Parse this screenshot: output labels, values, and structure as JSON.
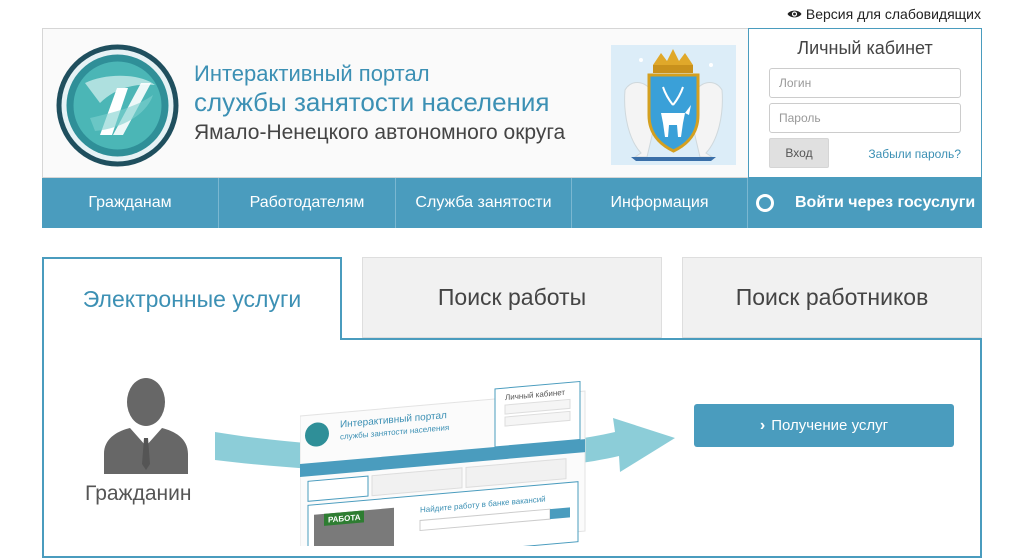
{
  "top": {
    "low_vision_label": "Версия для слабовидящих"
  },
  "header": {
    "title_line1": "Интерактивный портал",
    "title_line2": "службы занятости населения",
    "title_line3": "Ямало-Ненецкого автономного округа"
  },
  "login": {
    "title": "Личный кабинет",
    "login_placeholder": "Логин",
    "password_placeholder": "Пароль",
    "submit_label": "Вход",
    "forgot_label": "Забыли пароль?"
  },
  "nav": {
    "items": [
      "Гражданам",
      "Работодателям",
      "Служба занятости",
      "Информация"
    ],
    "gosuslugi_label": "Войти через госуслуги"
  },
  "tabs": [
    "Электронные услуги",
    "Поиск работы",
    "Поиск работников"
  ],
  "panel": {
    "citizen_label": "Гражданин",
    "service_button_label": "Получение услуг",
    "preview": {
      "portal_title_1": "Интерактивный портал",
      "portal_title_2": "службы занятости населения",
      "cabinet": "Личный кабинет",
      "search_label": "Найдите работу в банке вакансий",
      "work_sign": "РАБОТА"
    }
  },
  "colors": {
    "accent": "#4a9cbe",
    "title": "#3c90b4"
  },
  "icons": [
    "eye-icon",
    "portal-logo-icon",
    "yanao-emblem-icon",
    "gosuslugi-icon",
    "citizen-icon",
    "chevron-right-icon"
  ]
}
